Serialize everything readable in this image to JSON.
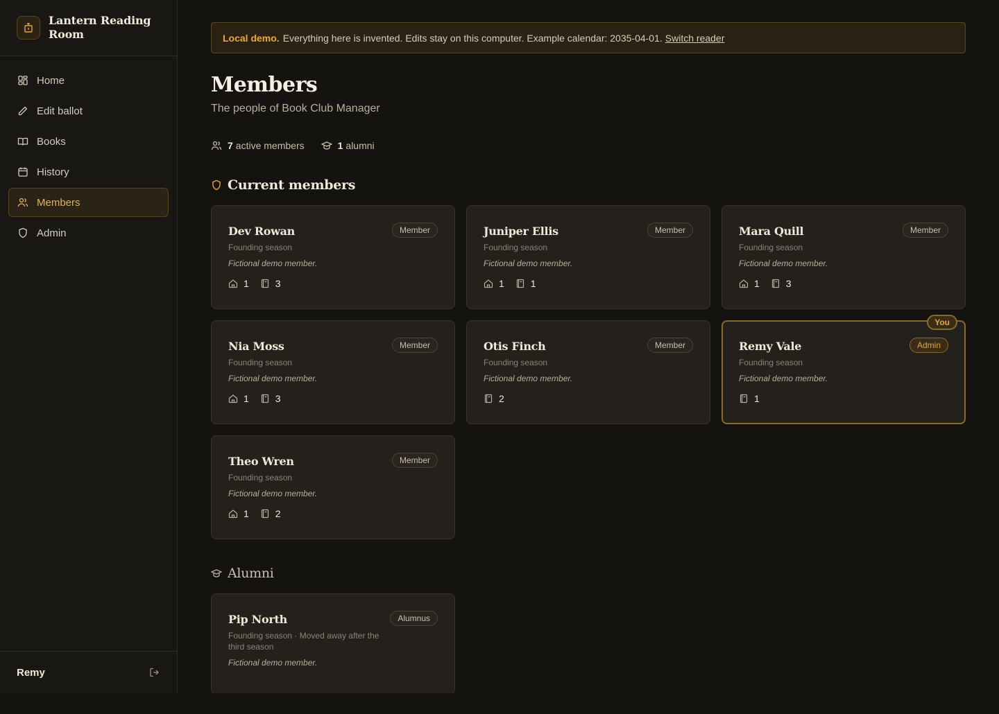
{
  "brand": {
    "name": "Lantern Reading Room"
  },
  "nav": [
    {
      "label": "Home",
      "icon": "dashboard-icon",
      "active": false
    },
    {
      "label": "Edit ballot",
      "icon": "pencil-icon",
      "active": false
    },
    {
      "label": "Books",
      "icon": "open-book-icon",
      "active": false
    },
    {
      "label": "History",
      "icon": "calendar-icon",
      "active": false
    },
    {
      "label": "Members",
      "icon": "users-icon",
      "active": true
    },
    {
      "label": "Admin",
      "icon": "shield-icon",
      "active": false
    }
  ],
  "user": {
    "name": "Remy"
  },
  "banner": {
    "strong": "Local demo.",
    "text": "Everything here is invented. Edits stay on this computer. Example calendar: 2035-04-01.",
    "link": "Switch reader"
  },
  "page": {
    "title": "Members",
    "subtitle": "The people of Book Club Manager"
  },
  "stats": {
    "active_count": "7",
    "active_label": "active members",
    "alumni_count": "1",
    "alumni_label": "alumni"
  },
  "sections": {
    "current": "Current members",
    "alumni": "Alumni"
  },
  "members": [
    {
      "name": "Dev Rowan",
      "role": "Member",
      "season": "Founding season",
      "note": "Fictional demo member.",
      "hosted": "1",
      "picked": "3"
    },
    {
      "name": "Juniper Ellis",
      "role": "Member",
      "season": "Founding season",
      "note": "Fictional demo member.",
      "hosted": "1",
      "picked": "1"
    },
    {
      "name": "Mara Quill",
      "role": "Member",
      "season": "Founding season",
      "note": "Fictional demo member.",
      "hosted": "1",
      "picked": "3"
    },
    {
      "name": "Nia Moss",
      "role": "Member",
      "season": "Founding season",
      "note": "Fictional demo member.",
      "hosted": "1",
      "picked": "3"
    },
    {
      "name": "Otis Finch",
      "role": "Member",
      "season": "Founding season",
      "note": "Fictional demo member.",
      "hosted": null,
      "picked": "2"
    },
    {
      "name": "Remy Vale",
      "role": "Admin",
      "season": "Founding season",
      "note": "Fictional demo member.",
      "hosted": null,
      "picked": "1",
      "you": "You"
    },
    {
      "name": "Theo Wren",
      "role": "Member",
      "season": "Founding season",
      "note": "Fictional demo member.",
      "hosted": "1",
      "picked": "2"
    }
  ],
  "alumni": [
    {
      "name": "Pip North",
      "role": "Alumnus",
      "season": "Founding season · Moved away after the third season",
      "note": "Fictional demo member."
    }
  ],
  "colors": {
    "accent": "#e0a840",
    "background": "#151310",
    "card": "#24201b"
  }
}
